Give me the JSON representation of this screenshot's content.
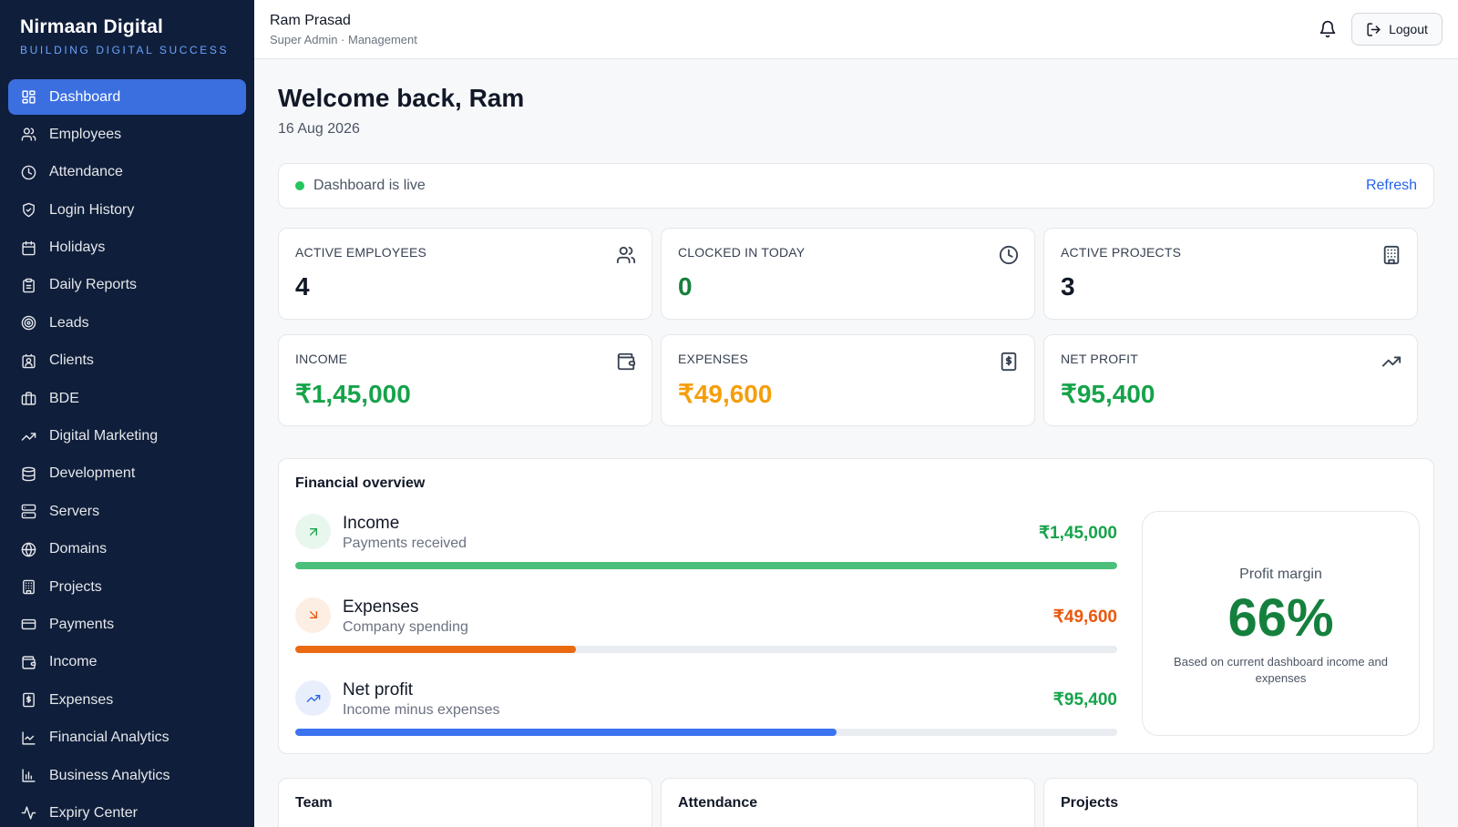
{
  "brand": {
    "name": "Nirmaan Digital",
    "tagline": "BUILDING DIGITAL SUCCESS"
  },
  "sidebar": {
    "items": [
      {
        "label": "Dashboard",
        "icon": "grid-icon",
        "active": true
      },
      {
        "label": "Employees",
        "icon": "users-icon"
      },
      {
        "label": "Attendance",
        "icon": "clock-icon"
      },
      {
        "label": "Login History",
        "icon": "shield-icon"
      },
      {
        "label": "Holidays",
        "icon": "calendar-icon"
      },
      {
        "label": "Daily Reports",
        "icon": "clipboard-icon"
      },
      {
        "label": "Leads",
        "icon": "target-icon"
      },
      {
        "label": "Clients",
        "icon": "contact-icon"
      },
      {
        "label": "BDE",
        "icon": "briefcase-icon"
      },
      {
        "label": "Digital Marketing",
        "icon": "trend-up-icon"
      },
      {
        "label": "Development",
        "icon": "database-icon"
      },
      {
        "label": "Servers",
        "icon": "server-icon"
      },
      {
        "label": "Domains",
        "icon": "globe-icon"
      },
      {
        "label": "Projects",
        "icon": "building-icon"
      },
      {
        "label": "Payments",
        "icon": "credit-card-icon"
      },
      {
        "label": "Income",
        "icon": "wallet-icon"
      },
      {
        "label": "Expenses",
        "icon": "receipt-icon"
      },
      {
        "label": "Financial Analytics",
        "icon": "line-chart-icon"
      },
      {
        "label": "Business Analytics",
        "icon": "bar-chart-icon"
      },
      {
        "label": "Expiry Center",
        "icon": "activity-icon"
      }
    ]
  },
  "header": {
    "user_name": "Ram Prasad",
    "user_role": "Super Admin · Management",
    "logout_label": "Logout"
  },
  "main": {
    "welcome": "Welcome back, Ram",
    "date": "16 Aug 2026",
    "live_text": "Dashboard is live",
    "refresh_label": "Refresh"
  },
  "stats": [
    {
      "label": "Active Employees",
      "value": "4",
      "icon": "users-icon",
      "color": "#111827"
    },
    {
      "label": "Clocked in today",
      "value": "0",
      "icon": "clock-icon",
      "color": "#15803d"
    },
    {
      "label": "Active Projects",
      "value": "3",
      "icon": "building-icon",
      "color": "#111827"
    },
    {
      "label": "Income",
      "value": "₹1,45,000",
      "icon": "wallet-icon",
      "color": "#16a34a"
    },
    {
      "label": "Expenses",
      "value": "₹49,600",
      "icon": "receipt-icon",
      "color": "#f59e0b"
    },
    {
      "label": "Net Profit",
      "value": "₹95,400",
      "icon": "trend-up-icon",
      "color": "#16a34a"
    }
  ],
  "financial": {
    "title": "Financial overview",
    "rows": [
      {
        "name": "Income",
        "sub": "Payments received",
        "amount": "₹1,45,000",
        "progress": 1.0,
        "color": "#4cbf7a",
        "amount_color": "#16a34a",
        "icon": "arrow-up-right-icon"
      },
      {
        "name": "Expenses",
        "sub": "Company spending",
        "amount": "₹49,600",
        "progress": 0.342,
        "color": "#ea6a12",
        "amount_color": "#ea580c",
        "icon": "arrow-down-right-icon"
      },
      {
        "name": "Net profit",
        "sub": "Income minus expenses",
        "amount": "₹95,400",
        "progress": 0.658,
        "color": "#3b73f0",
        "amount_color": "#16a34a",
        "icon": "trend-up-icon"
      }
    ],
    "margin_label": "Profit margin",
    "margin_value": "66%",
    "margin_note": "Based on current dashboard income and expenses"
  },
  "bottom_cards": [
    {
      "title": "Team"
    },
    {
      "title": "Attendance"
    },
    {
      "title": "Projects"
    }
  ]
}
